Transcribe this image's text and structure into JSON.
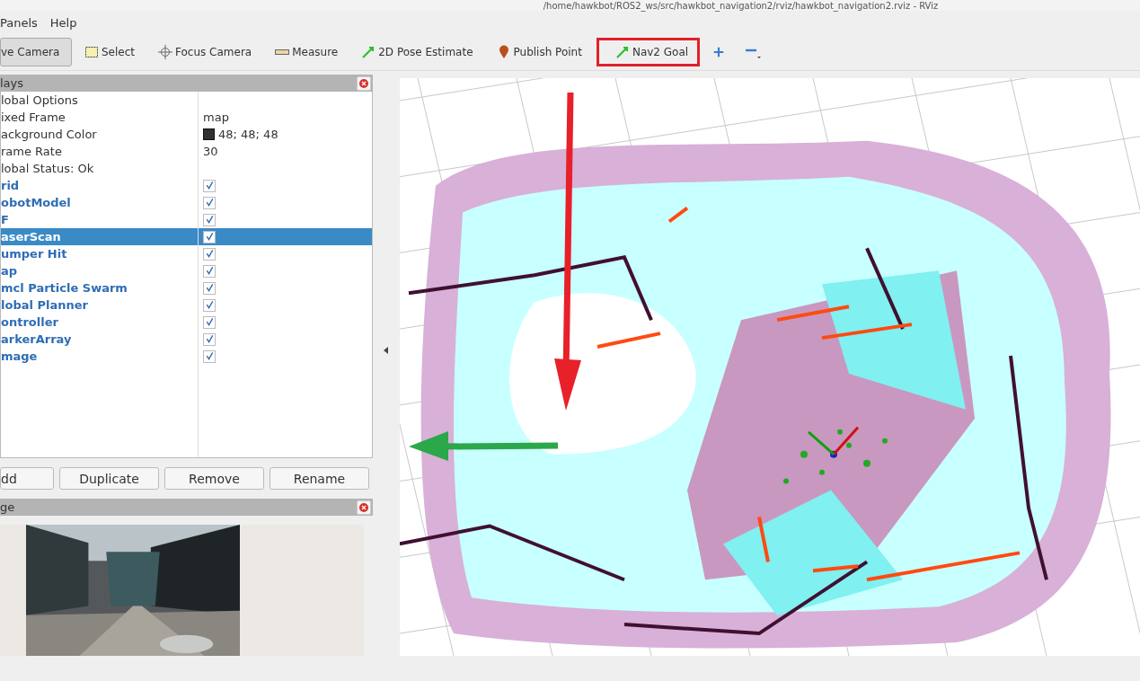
{
  "window": {
    "title": "/home/hawkbot/ROS2_ws/src/hawkbot_navigation2/rviz/hawkbot_navigation2.rviz - RViz"
  },
  "menu": [
    "Panels",
    "Help"
  ],
  "tools": [
    {
      "label": "ve Camera",
      "selected": true,
      "highlighted": false
    },
    {
      "label": "Select",
      "selected": false,
      "highlighted": false
    },
    {
      "label": "Focus Camera",
      "selected": false,
      "highlighted": false
    },
    {
      "label": "Measure",
      "selected": false,
      "highlighted": false
    },
    {
      "label": "2D Pose Estimate",
      "selected": false,
      "highlighted": false
    },
    {
      "label": "Publish Point",
      "selected": false,
      "highlighted": false
    },
    {
      "label": "Nav2 Goal",
      "selected": false,
      "highlighted": true
    }
  ],
  "displays_panel": {
    "title": "lays",
    "rows": [
      {
        "kind": "option",
        "name": "lobal Options",
        "selected": false
      },
      {
        "kind": "option",
        "name": "ixed Frame",
        "value": "map",
        "selected": false
      },
      {
        "kind": "option",
        "name": "ackground Color",
        "value": "48; 48; 48",
        "color": "#303030",
        "selected": false
      },
      {
        "kind": "option",
        "name": "rame Rate",
        "value": "30",
        "selected": false
      },
      {
        "kind": "option",
        "name": "lobal Status: Ok",
        "selected": false
      },
      {
        "kind": "display",
        "name": "rid",
        "checked": true,
        "selected": false
      },
      {
        "kind": "display",
        "name": "obotModel",
        "checked": true,
        "selected": false
      },
      {
        "kind": "display",
        "name": "F",
        "checked": true,
        "selected": false
      },
      {
        "kind": "display",
        "name": "aserScan",
        "checked": true,
        "selected": true
      },
      {
        "kind": "display",
        "name": "umper Hit",
        "checked": true,
        "selected": false
      },
      {
        "kind": "display",
        "name": "ap",
        "checked": true,
        "selected": false
      },
      {
        "kind": "display",
        "name": "mcl Particle Swarm",
        "checked": true,
        "selected": false
      },
      {
        "kind": "display",
        "name": "lobal Planner",
        "checked": true,
        "selected": false
      },
      {
        "kind": "display",
        "name": "ontroller",
        "checked": true,
        "selected": false
      },
      {
        "kind": "display",
        "name": "arkerArray",
        "checked": true,
        "selected": false
      },
      {
        "kind": "display",
        "name": "mage",
        "checked": true,
        "selected": false
      }
    ],
    "buttons": [
      "dd",
      "Duplicate",
      "Remove",
      "Rename"
    ]
  },
  "image_panel": {
    "title": "ge"
  }
}
